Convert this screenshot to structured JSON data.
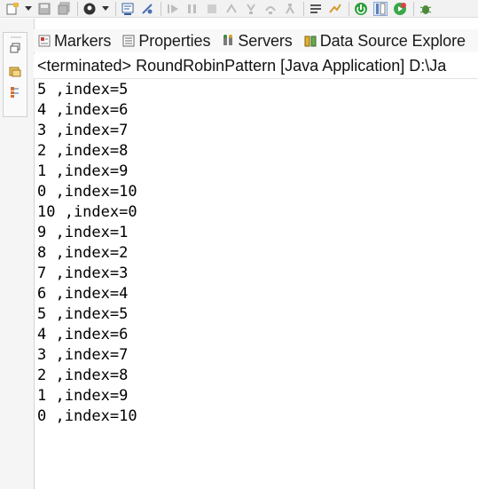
{
  "toolbar": {
    "icons": [
      "new-icon",
      "save-icon",
      "save-all-icon",
      "profile-icon",
      "console-icon",
      "breakpoint-icon",
      "resume-icon",
      "suspend-icon",
      "terminate-icon",
      "disconnect-icon",
      "step-into-icon",
      "step-over-icon",
      "step-return-icon",
      "task-icon",
      "run-to-line-icon",
      "spring-icon",
      "green-run-icon",
      "perspective-icon",
      "debug-icon"
    ]
  },
  "tabs": [
    {
      "label": "Markers",
      "icon": "markers-icon"
    },
    {
      "label": "Properties",
      "icon": "properties-icon"
    },
    {
      "label": "Servers",
      "icon": "servers-icon"
    },
    {
      "label": "Data Source Explore",
      "icon": "data-source-icon"
    }
  ],
  "console": {
    "header": "<terminated> RoundRobinPattern [Java Application] D:\\Ja",
    "lines": [
      "5 ,index=5",
      "4 ,index=6",
      "3 ,index=7",
      "2 ,index=8",
      "1 ,index=9",
      "0 ,index=10",
      "10 ,index=0",
      "9 ,index=1",
      "8 ,index=2",
      "7 ,index=3",
      "6 ,index=4",
      "5 ,index=5",
      "4 ,index=6",
      "3 ,index=7",
      "2 ,index=8",
      "1 ,index=9",
      "0 ,index=10"
    ]
  }
}
